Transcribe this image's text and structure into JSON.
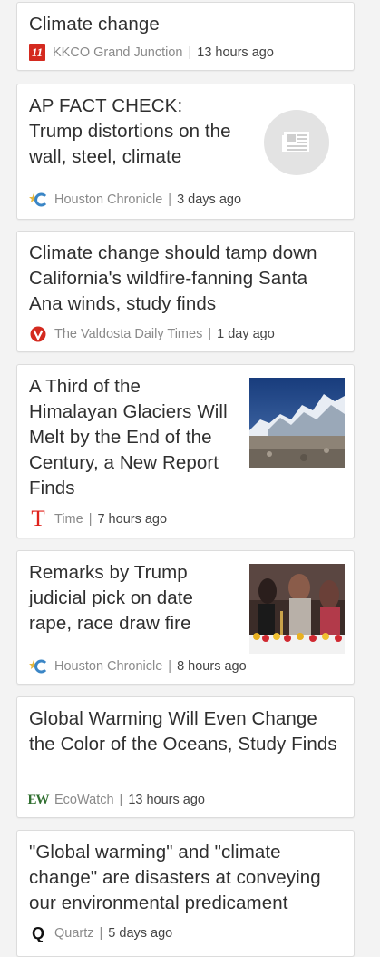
{
  "articles": [
    {
      "title": "Climate change",
      "source": "KKCO Grand Junction",
      "time": "13 hours ago"
    },
    {
      "title": "AP FACT CHECK: Trump distortions on the wall, steel, climate",
      "source": "Houston Chronicle",
      "time": "3 days ago"
    },
    {
      "title": "Climate change should tamp down California's wildfire-fanning Santa Ana winds, study finds",
      "source": "The Valdosta Daily Times",
      "time": "1 day ago"
    },
    {
      "title": "A Third of the Himalayan Glaciers Will Melt by the End of the Century, a New Report Finds",
      "source": "Time",
      "time": "7 hours ago"
    },
    {
      "title": "Remarks by Trump judicial pick on date rape, race draw fire",
      "source": "Houston Chronicle",
      "time": "8 hours ago"
    },
    {
      "title": "Global Warming Will Even Change the Color of the Oceans, Study Finds",
      "source": "EcoWatch",
      "time": "13 hours ago"
    },
    {
      "title": "\"Global warming\" and \"climate change\" are disasters at conveying our environmental predicament",
      "source": "Quartz",
      "time": "5 days ago"
    }
  ],
  "separator": "|",
  "logos": {
    "kkco": "11",
    "time": "T",
    "ecowatch": "EW",
    "quartz": "Q"
  },
  "icons": {
    "placeholder": "newspaper-icon",
    "houston": "houston-chronicle-logo-icon",
    "valdosta": "valdosta-logo-icon"
  },
  "colors": {
    "kkco": "#d42a1f",
    "valdosta": "#d42a1f",
    "time": "#e0221c",
    "ecowatch": "#2f6e2f",
    "houston": "#3b86c6"
  }
}
